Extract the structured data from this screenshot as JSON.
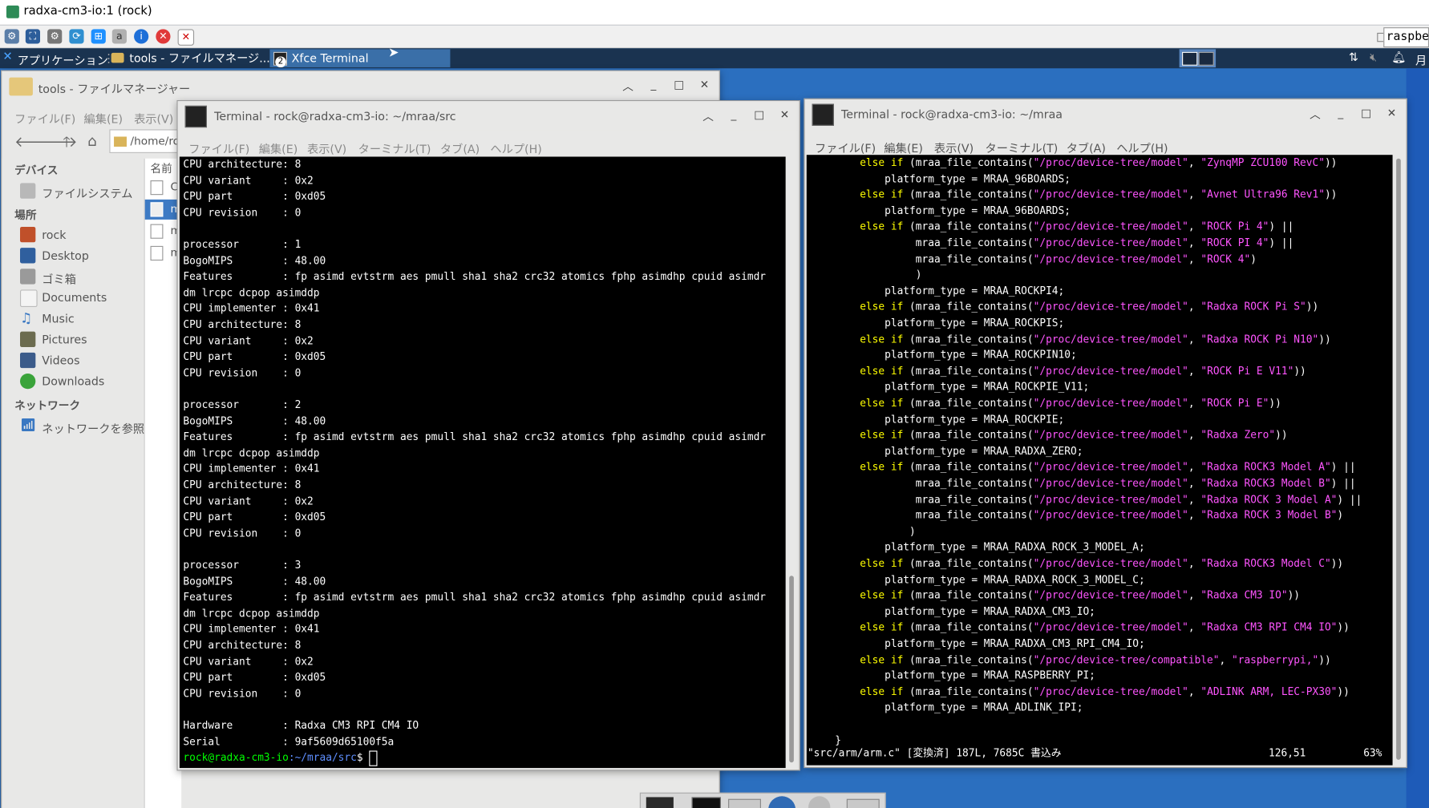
{
  "vnc": {
    "title": "radxa-cm3-io:1 (rock)",
    "search_value": "raspbe"
  },
  "panel": {
    "apps_label": "アプリケーション",
    "tasks": [
      {
        "label": "tools - ファイルマネージ..."
      },
      {
        "label": "Xfce Terminal",
        "badge": "2"
      }
    ],
    "clock_label": "月"
  },
  "file_manager": {
    "title": "tools - ファイルマネージャー",
    "menu": [
      "ファイル(F)",
      "編集(E)",
      "表示(V)"
    ],
    "path_value": "/home/ro",
    "column_header": "名前",
    "sections": {
      "devices": "デバイス",
      "places": "場所",
      "network": "ネットワーク"
    },
    "device_items": [
      "ファイルシステム"
    ],
    "place_items": [
      "rock",
      "Desktop",
      "ゴミ箱",
      "Documents",
      "Music",
      "Pictures",
      "Videos",
      "Downloads"
    ],
    "network_items": [
      "ネットワークを参照"
    ],
    "file_rows": [
      "C",
      "m",
      "m",
      "m"
    ]
  },
  "term_left": {
    "title": "Terminal - rock@radxa-cm3-io: ~/mraa/src",
    "menu": [
      "ファイル(F)",
      "編集(E)",
      "表示(V)",
      "ターミナル(T)",
      "タブ(A)",
      "ヘルプ(H)"
    ],
    "lines": [
      "CPU architecture: 8",
      "CPU variant     : 0x2",
      "CPU part        : 0xd05",
      "CPU revision    : 0",
      "",
      "processor       : 1",
      "BogoMIPS        : 48.00",
      "Features        : fp asimd evtstrm aes pmull sha1 sha2 crc32 atomics fphp asimdhp cpuid asimdr",
      "dm lrcpc dcpop asimddp",
      "CPU implementer : 0x41",
      "CPU architecture: 8",
      "CPU variant     : 0x2",
      "CPU part        : 0xd05",
      "CPU revision    : 0",
      "",
      "processor       : 2",
      "BogoMIPS        : 48.00",
      "Features        : fp asimd evtstrm aes pmull sha1 sha2 crc32 atomics fphp asimdhp cpuid asimdr",
      "dm lrcpc dcpop asimddp",
      "CPU implementer : 0x41",
      "CPU architecture: 8",
      "CPU variant     : 0x2",
      "CPU part        : 0xd05",
      "CPU revision    : 0",
      "",
      "processor       : 3",
      "BogoMIPS        : 48.00",
      "Features        : fp asimd evtstrm aes pmull sha1 sha2 crc32 atomics fphp asimdhp cpuid asimdr",
      "dm lrcpc dcpop asimddp",
      "CPU implementer : 0x41",
      "CPU architecture: 8",
      "CPU variant     : 0x2",
      "CPU part        : 0xd05",
      "CPU revision    : 0",
      "",
      "Hardware        : Radxa CM3 RPI CM4 IO",
      "Serial          : 9af5609d65100f5a"
    ],
    "prompt_user": "rock@radxa-cm3-io",
    "prompt_path": ":~/mraa/src",
    "prompt_symbol": "$ "
  },
  "term_right": {
    "title": "Terminal - rock@radxa-cm3-io: ~/mraa",
    "menu": [
      "ファイル(F)",
      "編集(E)",
      "表示(V)",
      "ターミナル(T)",
      "タブ(A)",
      "ヘルプ(H)"
    ],
    "code_lines": [
      [
        {
          "t": "        "
        },
        {
          "t": "else if",
          "c": "kw"
        },
        {
          "t": " (mraa_file_contains("
        },
        {
          "t": "\"/proc/device-tree/model\"",
          "c": "str"
        },
        {
          "t": ", "
        },
        {
          "t": "\"ZynqMP ZCU100 RevC\"",
          "c": "str"
        },
        {
          "t": "))"
        }
      ],
      [
        {
          "t": "            platform_type = MRAA_96BOARDS;"
        }
      ],
      [
        {
          "t": "        "
        },
        {
          "t": "else if",
          "c": "kw"
        },
        {
          "t": " (mraa_file_contains("
        },
        {
          "t": "\"/proc/device-tree/model\"",
          "c": "str"
        },
        {
          "t": ", "
        },
        {
          "t": "\"Avnet Ultra96 Rev1\"",
          "c": "str"
        },
        {
          "t": "))"
        }
      ],
      [
        {
          "t": "            platform_type = MRAA_96BOARDS;"
        }
      ],
      [
        {
          "t": "        "
        },
        {
          "t": "else if",
          "c": "kw"
        },
        {
          "t": " (mraa_file_contains("
        },
        {
          "t": "\"/proc/device-tree/model\"",
          "c": "str"
        },
        {
          "t": ", "
        },
        {
          "t": "\"ROCK Pi 4\"",
          "c": "str"
        },
        {
          "t": ") ||"
        }
      ],
      [
        {
          "t": "                 mraa_file_contains("
        },
        {
          "t": "\"/proc/device-tree/model\"",
          "c": "str"
        },
        {
          "t": ", "
        },
        {
          "t": "\"ROCK PI 4\"",
          "c": "str"
        },
        {
          "t": ") ||"
        }
      ],
      [
        {
          "t": "                 mraa_file_contains("
        },
        {
          "t": "\"/proc/device-tree/model\"",
          "c": "str"
        },
        {
          "t": ", "
        },
        {
          "t": "\"ROCK 4\"",
          "c": "str"
        },
        {
          "t": ")"
        }
      ],
      [
        {
          "t": "                 )"
        }
      ],
      [
        {
          "t": "            platform_type = MRAA_ROCKPI4;"
        }
      ],
      [
        {
          "t": "        "
        },
        {
          "t": "else if",
          "c": "kw"
        },
        {
          "t": " (mraa_file_contains("
        },
        {
          "t": "\"/proc/device-tree/model\"",
          "c": "str"
        },
        {
          "t": ", "
        },
        {
          "t": "\"Radxa ROCK Pi S\"",
          "c": "str"
        },
        {
          "t": "))"
        }
      ],
      [
        {
          "t": "            platform_type = MRAA_ROCKPIS;"
        }
      ],
      [
        {
          "t": "        "
        },
        {
          "t": "else if",
          "c": "kw"
        },
        {
          "t": " (mraa_file_contains("
        },
        {
          "t": "\"/proc/device-tree/model\"",
          "c": "str"
        },
        {
          "t": ", "
        },
        {
          "t": "\"Radxa ROCK Pi N10\"",
          "c": "str"
        },
        {
          "t": "))"
        }
      ],
      [
        {
          "t": "            platform_type = MRAA_ROCKPIN10;"
        }
      ],
      [
        {
          "t": "        "
        },
        {
          "t": "else if",
          "c": "kw"
        },
        {
          "t": " (mraa_file_contains("
        },
        {
          "t": "\"/proc/device-tree/model\"",
          "c": "str"
        },
        {
          "t": ", "
        },
        {
          "t": "\"ROCK Pi E V11\"",
          "c": "str"
        },
        {
          "t": "))"
        }
      ],
      [
        {
          "t": "            platform_type = MRAA_ROCKPIE_V11;"
        }
      ],
      [
        {
          "t": "        "
        },
        {
          "t": "else if",
          "c": "kw"
        },
        {
          "t": " (mraa_file_contains("
        },
        {
          "t": "\"/proc/device-tree/model\"",
          "c": "str"
        },
        {
          "t": ", "
        },
        {
          "t": "\"ROCK Pi E\"",
          "c": "str"
        },
        {
          "t": "))"
        }
      ],
      [
        {
          "t": "            platform_type = MRAA_ROCKPIE;"
        }
      ],
      [
        {
          "t": "        "
        },
        {
          "t": "else if",
          "c": "kw"
        },
        {
          "t": " (mraa_file_contains("
        },
        {
          "t": "\"/proc/device-tree/model\"",
          "c": "str"
        },
        {
          "t": ", "
        },
        {
          "t": "\"Radxa Zero\"",
          "c": "str"
        },
        {
          "t": "))"
        }
      ],
      [
        {
          "t": "            platform_type = MRAA_RADXA_ZERO;"
        }
      ],
      [
        {
          "t": "        "
        },
        {
          "t": "else if",
          "c": "kw"
        },
        {
          "t": " (mraa_file_contains("
        },
        {
          "t": "\"/proc/device-tree/model\"",
          "c": "str"
        },
        {
          "t": ", "
        },
        {
          "t": "\"Radxa ROCK3 Model A\"",
          "c": "str"
        },
        {
          "t": ") ||"
        }
      ],
      [
        {
          "t": "                 mraa_file_contains("
        },
        {
          "t": "\"/proc/device-tree/model\"",
          "c": "str"
        },
        {
          "t": ", "
        },
        {
          "t": "\"Radxa ROCK3 Model B\"",
          "c": "str"
        },
        {
          "t": ") ||"
        }
      ],
      [
        {
          "t": "                 mraa_file_contains("
        },
        {
          "t": "\"/proc/device-tree/model\"",
          "c": "str"
        },
        {
          "t": ", "
        },
        {
          "t": "\"Radxa ROCK 3 Model A\"",
          "c": "str"
        },
        {
          "t": ") ||"
        }
      ],
      [
        {
          "t": "                 mraa_file_contains("
        },
        {
          "t": "\"/proc/device-tree/model\"",
          "c": "str"
        },
        {
          "t": ", "
        },
        {
          "t": "\"Radxa ROCK 3 Model B\"",
          "c": "str"
        },
        {
          "t": ")"
        }
      ],
      [
        {
          "t": "                )"
        }
      ],
      [
        {
          "t": "            platform_type = MRAA_RADXA_ROCK_3_MODEL_A;"
        }
      ],
      [
        {
          "t": "        "
        },
        {
          "t": "else if",
          "c": "kw"
        },
        {
          "t": " (mraa_file_contains("
        },
        {
          "t": "\"/proc/device-tree/model\"",
          "c": "str"
        },
        {
          "t": ", "
        },
        {
          "t": "\"Radxa ROCK3 Model C\"",
          "c": "str"
        },
        {
          "t": "))"
        }
      ],
      [
        {
          "t": "            platform_type = MRAA_RADXA_ROCK_3_MODEL_C;"
        }
      ],
      [
        {
          "t": "        "
        },
        {
          "t": "else if",
          "c": "kw"
        },
        {
          "t": " (mraa_file_contains("
        },
        {
          "t": "\"/proc/device-tree/model\"",
          "c": "str"
        },
        {
          "t": ", "
        },
        {
          "t": "\"Radxa CM3 IO\"",
          "c": "str"
        },
        {
          "t": "))"
        }
      ],
      [
        {
          "t": "            platform_type = MRAA_RADXA_CM3_IO;"
        }
      ],
      [
        {
          "t": "        "
        },
        {
          "t": "else if",
          "c": "kw"
        },
        {
          "t": " (mraa_file_contains("
        },
        {
          "t": "\"/proc/device-tree/model\"",
          "c": "str"
        },
        {
          "t": ", "
        },
        {
          "t": "\"Radxa CM3 RPI CM4 IO\"",
          "c": "str"
        },
        {
          "t": "))"
        }
      ],
      [
        {
          "t": "            platform_type = MRAA_RADXA_CM3_RPI_CM4_IO;"
        }
      ],
      [
        {
          "t": "        "
        },
        {
          "t": "else if",
          "c": "kw"
        },
        {
          "t": " (mraa_file_contains("
        },
        {
          "t": "\"/proc/device-tree/compatible\"",
          "c": "str"
        },
        {
          "t": ", "
        },
        {
          "t": "\"raspberrypi,\"",
          "c": "str"
        },
        {
          "t": "))"
        }
      ],
      [
        {
          "t": "            platform_type = MRAA_RASPBERRY_PI;"
        }
      ],
      [
        {
          "t": "        "
        },
        {
          "t": "else if",
          "c": "kw"
        },
        {
          "t": " (mraa_file_contains("
        },
        {
          "t": "\"/proc/device-tree/model\"",
          "c": "str"
        },
        {
          "t": ", "
        },
        {
          "t": "\"ADLINK ARM, LEC-PX30\"",
          "c": "str"
        },
        {
          "t": "))"
        }
      ],
      [
        {
          "t": "            platform_type = MRAA_ADLINK_IPI;"
        }
      ],
      [
        {
          "t": ""
        }
      ],
      [
        {
          "t": "    }"
        }
      ]
    ],
    "status_file": "\"src/arm/arm.c\" [変換済] 187L, 7685C 書込み",
    "status_pos": "126,51",
    "status_pct": "63%"
  },
  "colors": {
    "keyword": "#ffff00",
    "string": "#ff55ff",
    "prompt": "#00ff00",
    "panel": "#1a3350"
  }
}
